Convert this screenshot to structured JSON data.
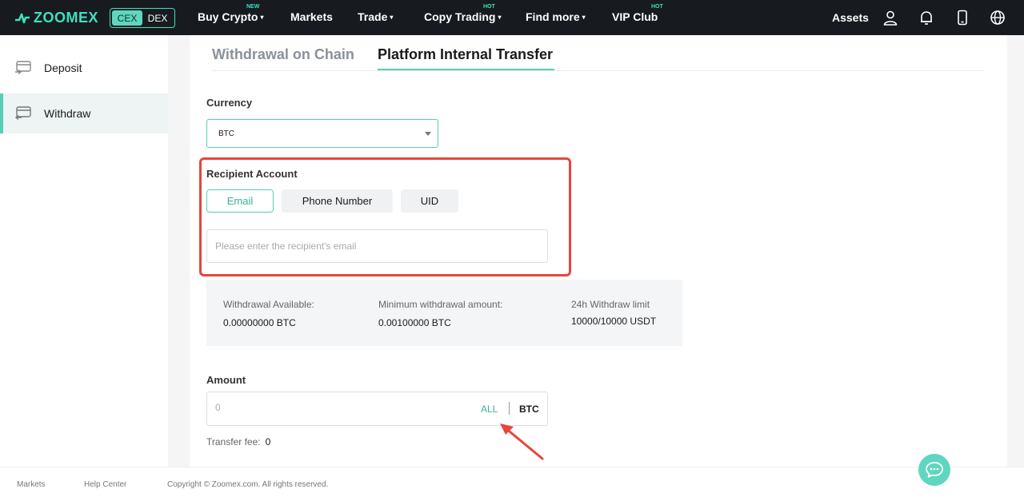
{
  "nav": {
    "logo": "ZOOMEX",
    "switch": [
      "CEX",
      "DEX"
    ],
    "items": [
      {
        "label": "Buy Crypto",
        "badge": "NEW",
        "caret": "▾"
      },
      {
        "label": "Markets",
        "badge": "",
        "caret": ""
      },
      {
        "label": "Trade",
        "badge": "",
        "caret": "▾"
      },
      {
        "label": "Copy Trading",
        "badge": "HOT",
        "caret": "▾"
      },
      {
        "label": "Find more",
        "badge": "",
        "caret": "▾"
      },
      {
        "label": "VIP Club",
        "badge": "HOT",
        "caret": ""
      }
    ],
    "assets": "Assets",
    "icons": [
      "user-icon",
      "bell-icon",
      "mobile-icon",
      "globe-icon"
    ]
  },
  "sidebar": {
    "items": [
      {
        "label": "Deposit",
        "icon": "deposit-card-icon",
        "active": false
      },
      {
        "label": "Withdraw",
        "icon": "withdraw-card-icon",
        "active": true
      }
    ]
  },
  "tabs": {
    "chain": "Withdrawal on Chain",
    "internal": "Platform Internal Transfer"
  },
  "currency": {
    "label": "Currency",
    "value": "BTC"
  },
  "recipient": {
    "label": "Recipient Account",
    "options": [
      "Email",
      "Phone Number",
      "UID"
    ],
    "selected": "Email",
    "placeholder": "Please enter the recipient's email"
  },
  "info": {
    "available_label": "Withdrawal Available:",
    "available_value": "0.00000000 BTC",
    "min_label": "Minimum withdrawal amount:",
    "min_value": "0.00100000 BTC",
    "limit_label": "24h Withdraw limit",
    "limit_value": "10000/10000 USDT"
  },
  "amount": {
    "label": "Amount",
    "placeholder": "0",
    "all": "ALL",
    "unit": "BTC",
    "fee_label": "Transfer fee:",
    "fee_value": "0"
  },
  "footer": {
    "markets": "Markets",
    "help": "Help Center",
    "copyright": "Copyright © Zoomex.com. All rights reserved."
  },
  "colors": {
    "accent": "#55cfb7",
    "highlight": "#e8453c",
    "nav_bg": "#171b20"
  }
}
